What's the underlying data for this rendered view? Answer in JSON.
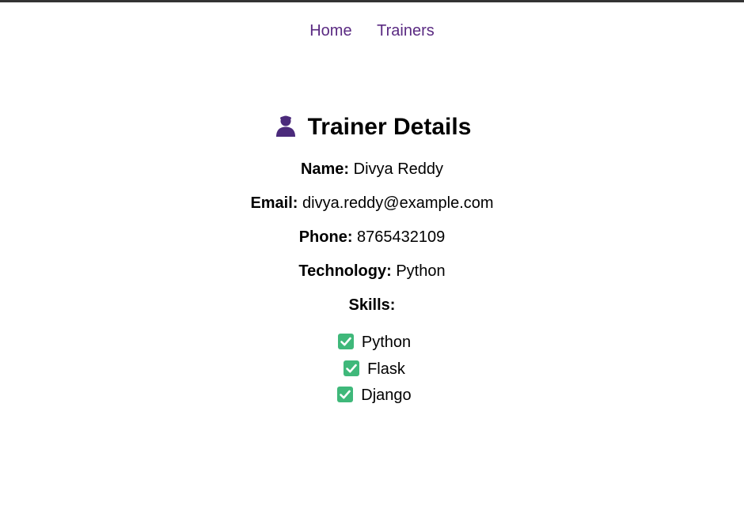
{
  "nav": {
    "items": [
      {
        "label": "Home"
      },
      {
        "label": "Trainers"
      }
    ]
  },
  "page": {
    "icon": "person-silhouette-icon",
    "title": "Trainer Details"
  },
  "details": {
    "name_label": "Name:",
    "name_value": "Divya Reddy",
    "email_label": "Email:",
    "email_value": "divya.reddy@example.com",
    "phone_label": "Phone:",
    "phone_value": "8765432109",
    "technology_label": "Technology:",
    "technology_value": "Python",
    "skills_label": "Skills:"
  },
  "skills": [
    {
      "icon": "check-mark-button-icon",
      "label": "Python"
    },
    {
      "icon": "check-mark-button-icon",
      "label": "Flask"
    },
    {
      "icon": "check-mark-button-icon",
      "label": "Django"
    }
  ],
  "colors": {
    "link": "#5a2a82",
    "icon_purple": "#4b2a7b",
    "check_green": "#3fb87a"
  }
}
